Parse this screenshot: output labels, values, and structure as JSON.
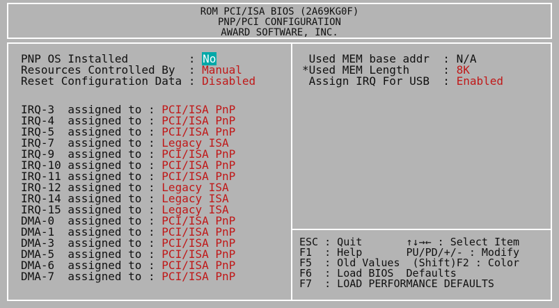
{
  "header": {
    "line1": "ROM PCI/ISA BIOS (2A69KG0F)",
    "line2": "PNP/PCI CONFIGURATION",
    "line3": "AWARD SOFTWARE, INC."
  },
  "left_settings": [
    {
      "label": "PNP OS Installed         : ",
      "value": "No",
      "selected": true
    },
    {
      "label": "Resources Controlled By  : ",
      "value": "Manual"
    },
    {
      "label": "Reset Configuration Data : ",
      "value": "Disabled"
    }
  ],
  "resources": [
    {
      "label": "IRQ-3  assigned to : ",
      "value": "PCI/ISA PnP"
    },
    {
      "label": "IRQ-4  assigned to : ",
      "value": "PCI/ISA PnP"
    },
    {
      "label": "IRQ-5  assigned to : ",
      "value": "PCI/ISA PnP"
    },
    {
      "label": "IRQ-7  assigned to : ",
      "value": "Legacy ISA"
    },
    {
      "label": "IRQ-9  assigned to : ",
      "value": "PCI/ISA PnP"
    },
    {
      "label": "IRQ-10 assigned to : ",
      "value": "PCI/ISA PnP"
    },
    {
      "label": "IRQ-11 assigned to : ",
      "value": "PCI/ISA PnP"
    },
    {
      "label": "IRQ-12 assigned to : ",
      "value": "Legacy ISA"
    },
    {
      "label": "IRQ-14 assigned to : ",
      "value": "Legacy ISA"
    },
    {
      "label": "IRQ-15 assigned to : ",
      "value": "Legacy ISA"
    },
    {
      "label": "DMA-0  assigned to : ",
      "value": "PCI/ISA PnP"
    },
    {
      "label": "DMA-1  assigned to : ",
      "value": "PCI/ISA PnP"
    },
    {
      "label": "DMA-3  assigned to : ",
      "value": "PCI/ISA PnP"
    },
    {
      "label": "DMA-5  assigned to : ",
      "value": "PCI/ISA PnP"
    },
    {
      "label": "DMA-6  assigned to : ",
      "value": "PCI/ISA PnP"
    },
    {
      "label": "DMA-7  assigned to : ",
      "value": "PCI/ISA PnP"
    }
  ],
  "right_settings": [
    {
      "label": " Used MEM base addr  : ",
      "value": "N/A"
    },
    {
      "label": "*Used MEM Length     : ",
      "value": "8K"
    },
    {
      "label": " Assign IRQ For USB  : ",
      "value": "Enabled"
    }
  ],
  "help": [
    "ESC : Quit       ↑↓→← : Select Item",
    "F1  : Help       PU/PD/+/- : Modify",
    "F5  : Old Values  (Shift)F2 : Color",
    "F6  : Load BIOS  Defaults",
    "F7  : LOAD PERFORMANCE DEFAULTS"
  ],
  "colors": {
    "background": "#b4b4b4",
    "value_text": "#c01818",
    "selected_bg": "#00a8a8",
    "border": "#ffffff"
  }
}
